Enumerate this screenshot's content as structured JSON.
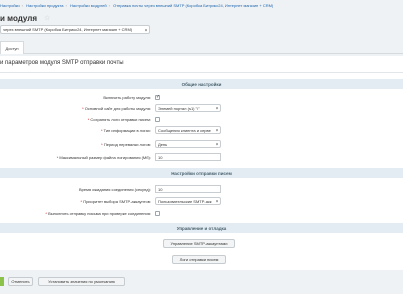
{
  "breadcrumbs": [
    "Настройки",
    "Настройки продукта",
    "Настройки модулей",
    "Отправка почты через внешний SMTP (Коробка Битрикс24, Интернет магазин + CRM)"
  ],
  "header": {
    "title": "и модуля"
  },
  "site_select": {
    "value": "через внешний SMTP (Коробка Битрикс24, Интернет магазин + CRM)"
  },
  "tabs": [
    {
      "label": "Доступ"
    }
  ],
  "panel": {
    "title": "и параметров модуля SMTP отправки почты"
  },
  "sections": {
    "general": {
      "title": "Общие настройки",
      "rows": [
        {
          "label": "Включить работу модуля:",
          "required": false,
          "type": "checkbox",
          "checked": true
        },
        {
          "label": "Основной сайт для работы модуля:",
          "required": true,
          "type": "select",
          "value": "Элемей портал (s1) \"/\""
        },
        {
          "label": "Сохранять логи отправки писем:",
          "required": true,
          "type": "checkbox",
          "checked": false
        },
        {
          "label": "Тип информации в логах:",
          "required": true,
          "type": "select",
          "value": "Сообщения клиента и серве"
        },
        {
          "label": "Период перевалки логов:",
          "required": true,
          "type": "select",
          "value": "День"
        },
        {
          "label": "Максимальный размер файла логирования (Мб):",
          "required": true,
          "type": "input",
          "value": "10"
        }
      ]
    },
    "sending": {
      "title": "Настройки отправки писем",
      "rows": [
        {
          "label": "Время ожидания соединения (секунд):",
          "required": false,
          "type": "input",
          "value": "10"
        },
        {
          "label": "Приоритет выбора SMTP-аккаунтов:",
          "required": true,
          "type": "select",
          "value": "Пользовательские SMTP-акк"
        },
        {
          "label": "Выполнять отправку письма при проверке соединения:",
          "required": true,
          "type": "checkbox",
          "checked": false
        }
      ]
    },
    "management": {
      "title": "Управление и отладка",
      "buttons": [
        {
          "label": "Управление SMTP-аккаунтами"
        },
        {
          "label": "Логи отправки писем"
        }
      ]
    }
  },
  "footer": {
    "cancel_label": "Отменить",
    "defaults_label": "Установить значения по умолчанию"
  },
  "colors": {
    "accent": "#8bc34a",
    "section_bg": "#e3ecf2",
    "link": "#2067b0",
    "required": "#d30000"
  }
}
